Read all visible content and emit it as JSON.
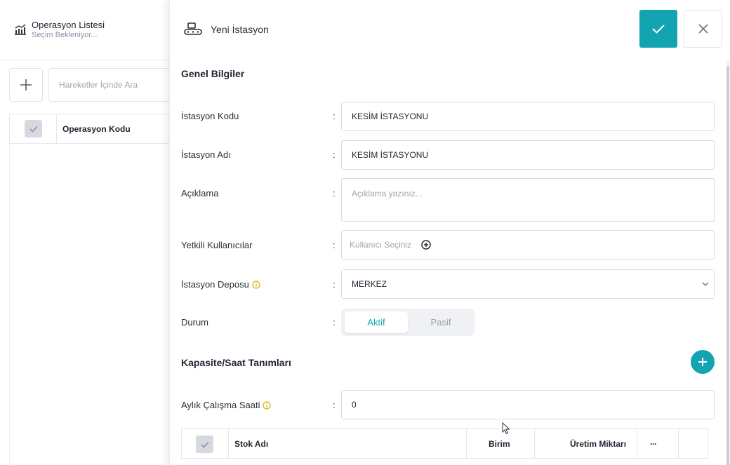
{
  "background": {
    "title": "Operasyon Listesi",
    "subtitle": "Seçim Bekleniyor...",
    "search_placeholder": "Hareketler İçinde Ara",
    "column_title": "Operasyon Kodu",
    "icon": "chart-icon"
  },
  "drawer": {
    "title": "Yeni İstasyon",
    "icon": "conveyor-icon",
    "colors": {
      "accent": "#14a4b1",
      "info": "#d4b400"
    },
    "sections": {
      "general": "Genel Bilgiler",
      "capacity": "Kapasite/Saat Tanımları"
    },
    "fields": {
      "code": {
        "label": "İstasyon Kodu",
        "value": "KESİM İSTASYONU"
      },
      "name": {
        "label": "İstasyon Adı",
        "value": "KESİM İSTASYONU"
      },
      "description": {
        "label": "Açıklama",
        "placeholder": "Açıklama yazınız..."
      },
      "users": {
        "label": "Yetkili Kullanıcılar",
        "placeholder": "Kullanıcı Seçiniz"
      },
      "warehouse": {
        "label": "İstasyon Deposu",
        "value": "MERKEZ"
      },
      "status": {
        "label": "Durum",
        "options": [
          "Aktif",
          "Pasif"
        ],
        "selected": "Aktif"
      },
      "monthly_hours": {
        "label": "Aylık Çalışma Saati",
        "value": "0"
      }
    },
    "colon": ":",
    "capacity_table": {
      "columns": [
        "Stok Adı",
        "Birim",
        "Üretim Miktarı",
        "···"
      ]
    }
  }
}
